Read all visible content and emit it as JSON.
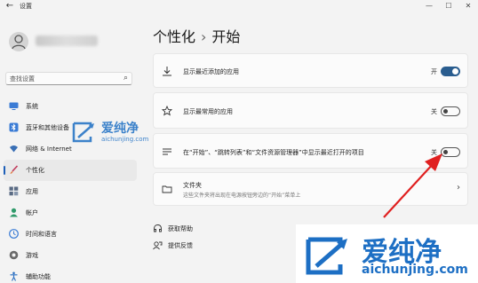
{
  "window": {
    "back_glyph": "←",
    "title": "设置",
    "controls": [
      "—",
      "☐",
      "✕"
    ]
  },
  "sidebar": {
    "search_placeholder": "查找设置",
    "items": [
      {
        "label": "系统",
        "icon": "monitor-icon",
        "active": false
      },
      {
        "label": "蓝牙和其他设备",
        "icon": "bluetooth-icon",
        "active": false
      },
      {
        "label": "网络 & Internet",
        "icon": "wifi-icon",
        "active": false
      },
      {
        "label": "个性化",
        "icon": "brush-icon",
        "active": true
      },
      {
        "label": "应用",
        "icon": "apps-icon",
        "active": false
      },
      {
        "label": "帐户",
        "icon": "person-icon",
        "active": false
      },
      {
        "label": "时间和语言",
        "icon": "clock-globe-icon",
        "active": false
      },
      {
        "label": "游戏",
        "icon": "gamepad-icon",
        "active": false
      },
      {
        "label": "辅助功能",
        "icon": "accessibility-icon",
        "active": false
      }
    ]
  },
  "main": {
    "breadcrumb_parent": "个性化",
    "breadcrumb_sep": "›",
    "breadcrumb_current": "开始",
    "settings": [
      {
        "label": "显示最近添加的应用",
        "state": "开",
        "on": true,
        "icon": "download-icon"
      },
      {
        "label": "显示最常用的应用",
        "state": "关",
        "on": false,
        "icon": "star-icon"
      },
      {
        "label": "在“开始”、“跳转列表”和“文件资源管理器”中显示最近打开的项目",
        "state": "关",
        "on": false,
        "icon": "list-icon"
      }
    ],
    "folders": {
      "label": "文件夹",
      "sub": "这些文件夹将出现在电源按钮旁边的“开始”菜单上",
      "chevron": "›"
    },
    "links": [
      {
        "label": "获取帮助",
        "icon": "help-icon"
      },
      {
        "label": "提供反馈",
        "icon": "feedback-icon"
      }
    ]
  },
  "watermarks": [
    {
      "name": "爱纯净",
      "url": "aichunjing.com"
    },
    {
      "name": "爱纯净",
      "url": "aichunjing.com"
    }
  ],
  "colors": {
    "accent": "#2a5d8f",
    "nav_indicator": "#1d5fb8",
    "annotation_arrow": "#e02020",
    "watermark": "#1d6fc4"
  }
}
